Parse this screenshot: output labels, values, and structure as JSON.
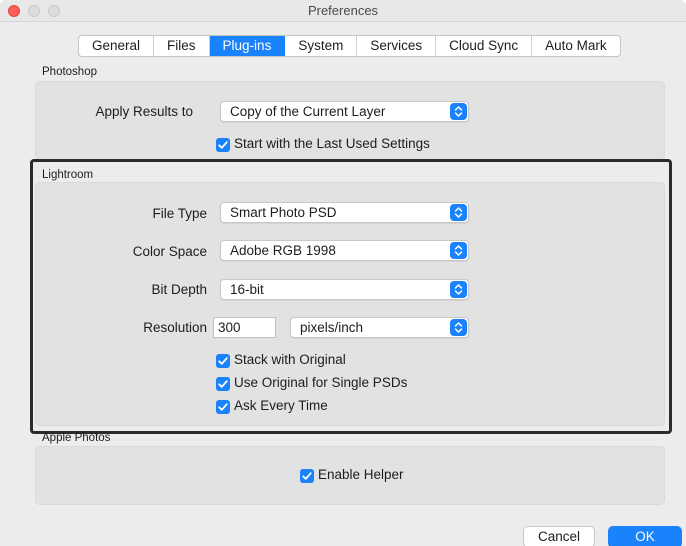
{
  "window": {
    "title": "Preferences"
  },
  "tabs": [
    {
      "label": "General",
      "active": false
    },
    {
      "label": "Files",
      "active": false
    },
    {
      "label": "Plug-ins",
      "active": true
    },
    {
      "label": "System",
      "active": false
    },
    {
      "label": "Services",
      "active": false
    },
    {
      "label": "Cloud Sync",
      "active": false
    },
    {
      "label": "Auto Mark",
      "active": false
    }
  ],
  "photoshop": {
    "section_label": "Photoshop",
    "apply_results_label": "Apply Results to",
    "apply_results_value": "Copy of the Current Layer",
    "start_last_used_label": "Start with the Last Used Settings",
    "start_last_used_checked": true
  },
  "lightroom": {
    "section_label": "Lightroom",
    "file_type_label": "File Type",
    "file_type_value": "Smart Photo PSD",
    "color_space_label": "Color Space",
    "color_space_value": "Adobe RGB 1998",
    "bit_depth_label": "Bit Depth",
    "bit_depth_value": "16-bit",
    "resolution_label": "Resolution",
    "resolution_value": "300",
    "resolution_unit": "pixels/inch",
    "stack_label": "Stack with Original",
    "stack_checked": true,
    "use_original_label": "Use Original for Single PSDs",
    "use_original_checked": true,
    "ask_every_time_label": "Ask Every Time",
    "ask_every_time_checked": true
  },
  "apple_photos": {
    "section_label": "Apple Photos",
    "enable_helper_label": "Enable Helper",
    "enable_helper_checked": true
  },
  "buttons": {
    "cancel": "Cancel",
    "ok": "OK"
  },
  "colors": {
    "accent": "#1a82fb",
    "window_bg": "#ececec",
    "group_bg": "#e2e2e2",
    "highlight_border": "#2b2b2b"
  },
  "icons": {
    "checkbox": "checkmark-icon",
    "popup": "up-down-chevron-icon"
  }
}
